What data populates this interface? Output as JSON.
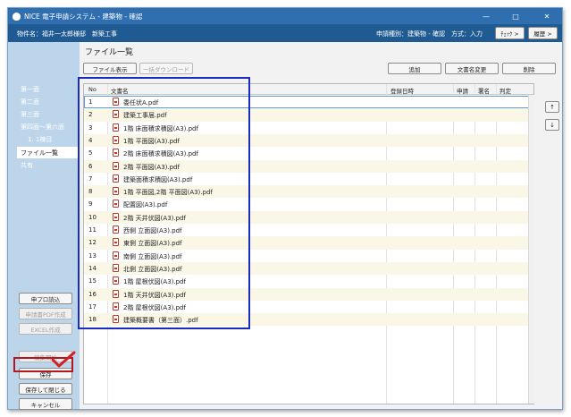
{
  "window": {
    "title": "NICE 電子申請システム - 建築物 - 確認",
    "controls": [
      "—",
      "□",
      "✕"
    ]
  },
  "infobar": {
    "property_label": "物件名：",
    "property_name": "福井一太郎様邸　新築工事",
    "apply_type": "申請種別：建築物 - 確認　方式：入力",
    "check_button": "ﾁｪｯｸ >",
    "history_button": "履歴 >"
  },
  "sidebar": {
    "items": [
      "第一面",
      "第二面",
      "第三面",
      "第四面～第六面",
      "1. 1棟目",
      "ファイル一覧",
      "共有"
    ],
    "active_index": 5,
    "buttons": {
      "load": "申プロ読込",
      "pdf": "申請書PDF作成",
      "excel": "EXCEL作成",
      "edit_start": "編集開始",
      "save": "保存",
      "save_close": "保存して閉じる",
      "cancel": "キャンセル"
    }
  },
  "main": {
    "heading": "ファイル一覧",
    "buttons": {
      "show_file": "ファイル表示",
      "bulk_download": "一括ダウンロード",
      "add": "追加",
      "rename": "文書名変更",
      "delete": "削除"
    },
    "columns": [
      "No",
      "文書名",
      "登録日時",
      "申請",
      "署名",
      "判定"
    ],
    "rows": [
      {
        "no": "1",
        "name": "委任状A.pdf"
      },
      {
        "no": "2",
        "name": "建築工事届.pdf"
      },
      {
        "no": "3",
        "name": "1階 床面積求積図(A3).pdf"
      },
      {
        "no": "4",
        "name": "1階 平面図(A3).pdf"
      },
      {
        "no": "5",
        "name": "2階 床面積求積図(A3).pdf"
      },
      {
        "no": "6",
        "name": "2階 平面図(A3).pdf"
      },
      {
        "no": "7",
        "name": "建築面積求積図(A3).pdf"
      },
      {
        "no": "8",
        "name": "1階 平面図,2階 平面図(A3).pdf"
      },
      {
        "no": "9",
        "name": "配置図(A3).pdf"
      },
      {
        "no": "10",
        "name": "2階 天井伏図(A3).pdf"
      },
      {
        "no": "11",
        "name": "西側 立面図(A3).pdf"
      },
      {
        "no": "12",
        "name": "東側 立面図(A3).pdf"
      },
      {
        "no": "13",
        "name": "南側 立面図(A3).pdf"
      },
      {
        "no": "14",
        "name": "北側 立面図(A3).pdf"
      },
      {
        "no": "15",
        "name": "1階 屋根伏図(A3).pdf"
      },
      {
        "no": "16",
        "name": "1階 天井伏図(A3).pdf"
      },
      {
        "no": "17",
        "name": "2階 屋根伏図(A3).pdf"
      },
      {
        "no": "18",
        "name": "建築概要書（第三面）.pdf"
      }
    ],
    "move_up": "↑",
    "move_down": "↓"
  },
  "colors": {
    "titlebar": "#2f6fb0",
    "infobar": "#1f5a92",
    "sidebar": "#bcd5ea",
    "highlight_blue": "#1a2bbf",
    "highlight_red": "#b4181f",
    "checkmark": "#d21f26"
  }
}
